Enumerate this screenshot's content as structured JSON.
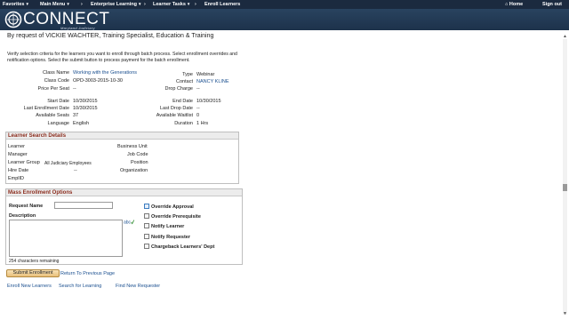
{
  "topnav": {
    "favorites": "Favorites",
    "main_menu": "Main Menu",
    "crumb1": "Enterprise Learning",
    "crumb2": "Learner Tasks",
    "crumb3": "Enroll Learners",
    "home": "Home",
    "signout": "Sign out"
  },
  "banner": {
    "brand": "CONNECT",
    "sub": "Maryland Judiciary"
  },
  "request_line": "By request of VICKIE WACHTER, Training Specialist, Education & Training",
  "intro": "Verify selection criteria for the learners you want to enroll through batch process. Select enrollment overrides and notification options. Select the submit button to process payment for the batch enrollment.",
  "class_info": {
    "class_name_label": "Class Name",
    "class_name": "Working with the Generations",
    "class_code_label": "Class Code",
    "class_code": "OPD-3003-2015-10-30",
    "price_label": "Price Per Seat",
    "price": "--",
    "type_label": "Type",
    "type": "Webinar",
    "contact_label": "Contact",
    "contact": "NANCY KLINE",
    "drop_charge_label": "Drop Charge",
    "drop_charge": "--",
    "start_date_label": "Start Date",
    "start_date": "10/30/2015",
    "last_enroll_label": "Last Enrollment Date",
    "last_enroll": "10/30/2015",
    "avail_seats_label": "Available Seats",
    "avail_seats": "37",
    "language_label": "Language",
    "language": "English",
    "end_date_label": "End Date",
    "end_date": "10/30/2015",
    "last_drop_label": "Last Drop Date",
    "last_drop": "--",
    "avail_waitlist_label": "Available Waitlist",
    "avail_waitlist": "0",
    "duration_label": "Duration",
    "duration": "1 Hrs"
  },
  "learner_search": {
    "title": "Learner Search Details",
    "learner": "Learner",
    "manager": "Manager",
    "learner_group": "Learner Group",
    "learner_group_value": "All Judiciary Employees",
    "hire_date": "Hire Date",
    "hire_date_value": "--",
    "emplid": "EmplID",
    "business_unit": "Business Unit",
    "job_code": "Job Code",
    "position": "Position",
    "organization": "Organization"
  },
  "mass_enrollment": {
    "title": "Mass Enrollment Options",
    "request_name": "Request Name",
    "request_name_value": "",
    "description": "Description",
    "description_value": "",
    "chars_remaining": "254 characters remaining",
    "override_approval": "Override Approval",
    "override_prereq": "Override Prerequisite",
    "notify_learner": "Notify Learner",
    "notify_requester": "Notify Requester",
    "chargeback": "Chargeback Learners' Dept"
  },
  "actions": {
    "submit": "Submit Enrollment",
    "return": "Return To Previous Page",
    "enroll_new": "Enroll New Learners",
    "search_learning": "Search for Learning",
    "find_requester": "Find New Requester"
  }
}
